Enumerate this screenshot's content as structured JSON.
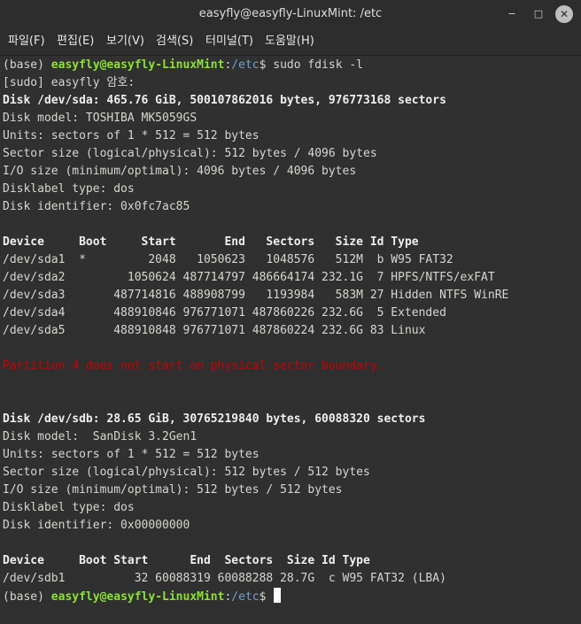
{
  "window": {
    "title": "easyfly@easyfly-LinuxMint: /etc",
    "minimize_glyph": "‒",
    "maximize_glyph": "□",
    "close_glyph": "✕"
  },
  "menu": [
    "파일(F)",
    "편집(E)",
    "보기(V)",
    "검색(S)",
    "터미널(T)",
    "도움말(H)"
  ],
  "prompt": {
    "env": "(base) ",
    "userhost": "easyfly@easyfly-LinuxMint",
    "colon": ":",
    "path": "/etc",
    "dollar": "$ ",
    "command": "sudo fdisk -l"
  },
  "lines": [
    "[sudo] easyfly 암호:",
    "Disk /dev/sda: 465.76 GiB, 500107862016 bytes, 976773168 sectors",
    "Disk model: TOSHIBA MK5059GS",
    "Units: sectors of 1 * 512 = 512 bytes",
    "Sector size (logical/physical): 512 bytes / 4096 bytes",
    "I/O size (minimum/optimal): 4096 bytes / 4096 bytes",
    "Disklabel type: dos",
    "Disk identifier: 0x0fc7ac85",
    "",
    "Device     Boot     Start       End   Sectors   Size Id Type",
    "/dev/sda1  *         2048   1050623   1048576   512M  b W95 FAT32",
    "/dev/sda2         1050624 487714797 486664174 232.1G  7 HPFS/NTFS/exFAT",
    "/dev/sda3       487714816 488908799   1193984   583M 27 Hidden NTFS WinRE",
    "/dev/sda4       488910846 976771071 487860226 232.6G  5 Extended",
    "/dev/sda5       488910848 976771071 487860224 232.6G 83 Linux",
    "",
    "Partition 4 does not start on physical sector boundary.",
    "",
    "",
    "Disk /dev/sdb: 28.65 GiB, 30765219840 bytes, 60088320 sectors",
    "Disk model:  SanDisk 3.2Gen1",
    "Units: sectors of 1 * 512 = 512 bytes",
    "Sector size (logical/physical): 512 bytes / 512 bytes",
    "I/O size (minimum/optimal): 512 bytes / 512 bytes",
    "Disklabel type: dos",
    "Disk identifier: 0x00000000",
    "",
    "Device     Boot Start      End  Sectors  Size Id Type",
    "/dev/sdb1          32 60088319 60088288 28.7G  c W95 FAT32 (LBA)"
  ],
  "colors": {
    "background": "#303030",
    "text": "#d3d7cf",
    "prompt_user": "#8ae234",
    "prompt_path": "#729fcf",
    "error": "#cc0000"
  }
}
